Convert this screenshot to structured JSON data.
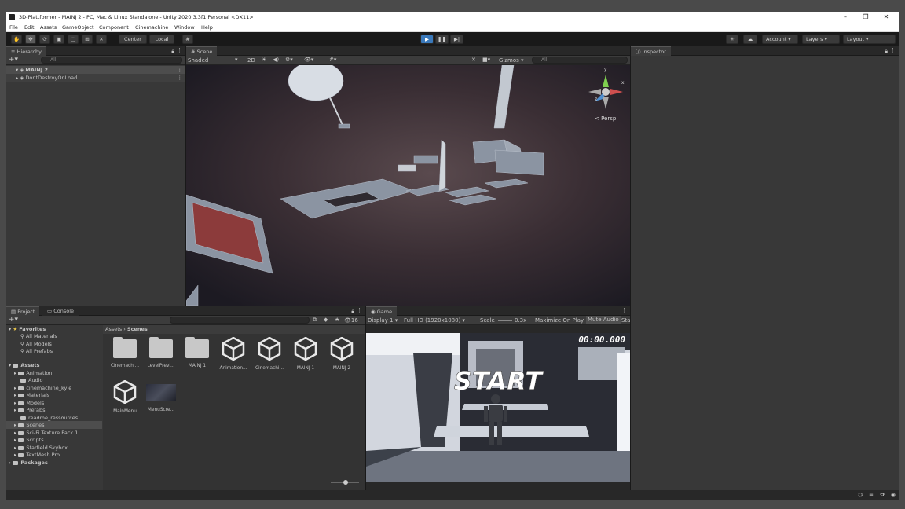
{
  "window": {
    "title": "3D-Plattformer - MAINJ 2 - PC, Mac & Linux Standalone - Unity 2020.3.3f1 Personal <DX11>"
  },
  "menu": [
    "File",
    "Edit",
    "Assets",
    "GameObject",
    "Component",
    "Cinemachine",
    "Window",
    "Help"
  ],
  "toolbar": {
    "pivot": "Center",
    "space": "Local",
    "account": "Account",
    "layers": "Layers",
    "layout": "Layout"
  },
  "hierarchy": {
    "tab": "Hierarchy",
    "search_placeholder": "All",
    "items": [
      "MAINJ 2",
      "DontDestroyOnLoad"
    ]
  },
  "scene": {
    "tab": "Scene",
    "shading": "Shaded",
    "mode_2d": "2D",
    "gizmos": "Gizmos",
    "search_placeholder": "All",
    "persp": "< Persp",
    "axis_y": "y",
    "axis_x": "x",
    "axis_z": "z"
  },
  "inspector": {
    "tab": "Inspector"
  },
  "project": {
    "tab": "Project",
    "console_tab": "Console",
    "favorites": "Favorites",
    "fav_items": [
      "All Materials",
      "All Models",
      "All Prefabs"
    ],
    "assets_root": "Assets",
    "folders": [
      "Animation",
      "Audio",
      "cinemachine_kyle",
      "Materials",
      "Models",
      "Prefabs",
      "readme_ressources",
      "Scenes",
      "Sci-Fi Texture Pack 1",
      "Scripts",
      "Starfield Skybox",
      "TextMesh Pro"
    ],
    "packages": "Packages",
    "breadcrumb_root": "Assets",
    "breadcrumb_current": "Scenes",
    "count": "16",
    "assets": [
      "Cinemachi...",
      "LevelPrevi...",
      "MAINJ 1",
      "Animation...",
      "Cinemachi...",
      "MAINJ 1",
      "MAINJ 2",
      "MainMenu",
      "MenuScre..."
    ]
  },
  "game": {
    "tab": "Game",
    "display": "Display 1",
    "resolution": "Full HD (1920x1080)",
    "scale_label": "Scale",
    "scale_value": "0.3x",
    "maximize": "Maximize On Play",
    "mute": "Mute Audio",
    "stats": "Sta",
    "timer": "00:00.000",
    "start": "START"
  },
  "colors": {
    "accent": "#3a79bb",
    "bg": "#383838",
    "start_text": "#ffffff"
  }
}
